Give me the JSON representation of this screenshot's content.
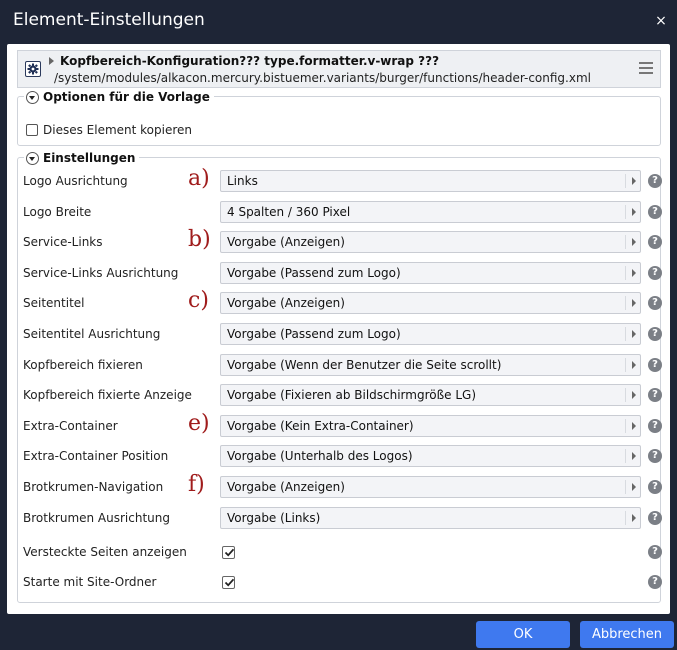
{
  "dialog": {
    "title": "Element-Einstellungen",
    "close_glyph": "×"
  },
  "element": {
    "title": "Kopfbereich-Konfiguration??? type.formatter.v-wrap ???",
    "path": "/system/modules/alkacon.mercury.bistuemer.variants/burger/functions/header-config.xml",
    "icon": "gear-icon",
    "menu_icon": "hamburger-menu-icon"
  },
  "template_options": {
    "legend": "Optionen für die Vorlage",
    "copy_label": "Dieses Element kopieren",
    "copy_checked": false
  },
  "settings": {
    "legend": "Einstellungen",
    "rows": [
      {
        "label": "Logo Ausrichtung",
        "value": "Links",
        "marker": "a)"
      },
      {
        "label": "Logo Breite",
        "value": "4 Spalten / 360 Pixel",
        "marker": ""
      },
      {
        "label": "Service-Links",
        "value": "Vorgabe (Anzeigen)",
        "marker": "b)"
      },
      {
        "label": "Service-Links Ausrichtung",
        "value": "Vorgabe (Passend zum Logo)",
        "marker": ""
      },
      {
        "label": "Seitentitel",
        "value": "Vorgabe (Anzeigen)",
        "marker": "c)"
      },
      {
        "label": "Seitentitel Ausrichtung",
        "value": "Vorgabe (Passend zum Logo)",
        "marker": ""
      },
      {
        "label": "Kopfbereich fixieren",
        "value": "Vorgabe (Wenn der Benutzer die Seite scrollt)",
        "marker": ""
      },
      {
        "label": "Kopfbereich fixierte Anzeige",
        "value": "Vorgabe (Fixieren ab Bildschirmgröße LG)",
        "marker": ""
      },
      {
        "label": "Extra-Container",
        "value": "Vorgabe (Kein Extra-Container)",
        "marker": "e)"
      },
      {
        "label": "Extra-Container Position",
        "value": "Vorgabe (Unterhalb des Logos)",
        "marker": ""
      },
      {
        "label": "Brotkrumen-Navigation",
        "value": "Vorgabe (Anzeigen)",
        "marker": "f)"
      },
      {
        "label": "Brotkrumen Ausrichtung",
        "value": "Vorgabe (Links)",
        "marker": ""
      }
    ],
    "checks": [
      {
        "label": "Versteckte Seiten anzeigen",
        "checked": true
      },
      {
        "label": "Starte mit Site-Ordner",
        "checked": true
      }
    ],
    "help_glyph": "?"
  },
  "footer": {
    "ok_label": "OK",
    "cancel_label": "Abbrechen"
  },
  "colors": {
    "chrome": "#1e2536",
    "button": "#3f79ef",
    "marker": "#a01c1c"
  }
}
